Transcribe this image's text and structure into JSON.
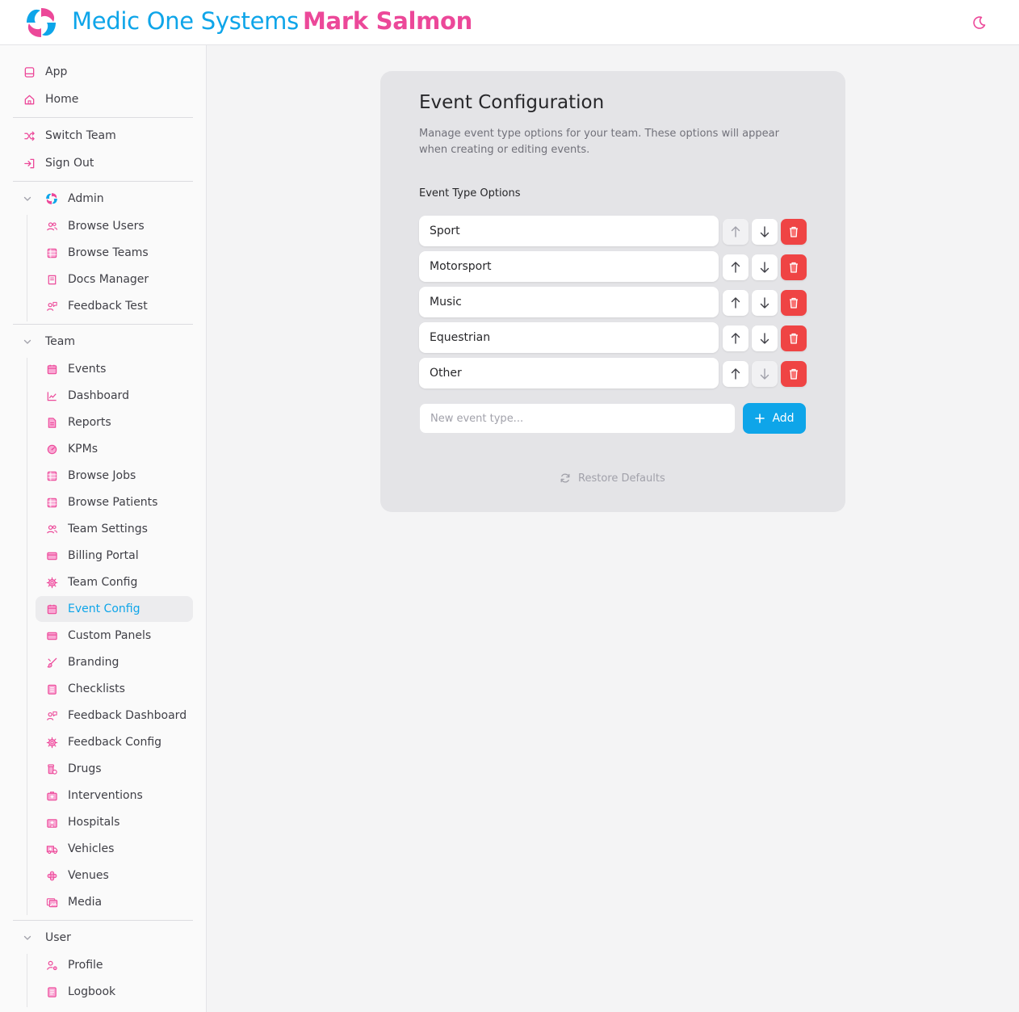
{
  "header": {
    "brand": "Medic One Systems",
    "user_name": "Mark Salmon",
    "logo_icon": "swirl-logo-icon",
    "theme_icon": "moon-icon"
  },
  "colors": {
    "accent_blue": "#0ea5e9",
    "accent_pink": "#ec4899",
    "danger": "#ef4444"
  },
  "sidebar": {
    "top_items": [
      {
        "label": "App",
        "icon": "app-icon"
      },
      {
        "label": "Home",
        "icon": "home-icon"
      }
    ],
    "account_items": [
      {
        "label": "Switch Team",
        "icon": "shuffle-icon"
      },
      {
        "label": "Sign Out",
        "icon": "sign-out-icon"
      }
    ],
    "admin": {
      "label": "Admin",
      "items": [
        {
          "label": "Browse Users",
          "icon": "users-icon"
        },
        {
          "label": "Browse Teams",
          "icon": "table-icon"
        },
        {
          "label": "Docs Manager",
          "icon": "book-icon"
        },
        {
          "label": "Feedback Test",
          "icon": "user-feedback-icon"
        }
      ]
    },
    "team": {
      "label": "Team",
      "items": [
        {
          "label": "Events",
          "icon": "calendar-icon"
        },
        {
          "label": "Dashboard",
          "icon": "chart-icon"
        },
        {
          "label": "Reports",
          "icon": "document-icon"
        },
        {
          "label": "KPMs",
          "icon": "gauge-icon"
        },
        {
          "label": "Browse Jobs",
          "icon": "table-icon"
        },
        {
          "label": "Browse Patients",
          "icon": "table-icon"
        },
        {
          "label": "Team Settings",
          "icon": "users-icon"
        },
        {
          "label": "Billing Portal",
          "icon": "credit-card-icon"
        },
        {
          "label": "Team Config",
          "icon": "cog-icon"
        },
        {
          "label": "Event Config",
          "icon": "calendar-icon",
          "active": true
        },
        {
          "label": "Custom Panels",
          "icon": "credit-card-icon"
        },
        {
          "label": "Branding",
          "icon": "brush-icon"
        },
        {
          "label": "Checklists",
          "icon": "clipboard-icon"
        },
        {
          "label": "Feedback Dashboard",
          "icon": "user-feedback-icon"
        },
        {
          "label": "Feedback Config",
          "icon": "cog-icon"
        },
        {
          "label": "Drugs",
          "icon": "pill-bottle-icon"
        },
        {
          "label": "Interventions",
          "icon": "medical-bag-icon"
        },
        {
          "label": "Hospitals",
          "icon": "hospital-icon"
        },
        {
          "label": "Vehicles",
          "icon": "ambulance-icon"
        },
        {
          "label": "Venues",
          "icon": "flower-icon"
        },
        {
          "label": "Media",
          "icon": "images-icon"
        }
      ]
    },
    "user": {
      "label": "User",
      "items": [
        {
          "label": "Profile",
          "icon": "user-cog-icon"
        },
        {
          "label": "Logbook",
          "icon": "notebook-icon"
        }
      ]
    }
  },
  "main": {
    "title": "Event Configuration",
    "description": "Manage event type options for your team. These options will appear when creating or editing events.",
    "section_label": "Event Type Options",
    "options": [
      {
        "label": "Sport",
        "up_disabled": true,
        "down_disabled": false
      },
      {
        "label": "Motorsport",
        "up_disabled": false,
        "down_disabled": false
      },
      {
        "label": "Music",
        "up_disabled": false,
        "down_disabled": false
      },
      {
        "label": "Equestrian",
        "up_disabled": false,
        "down_disabled": false
      },
      {
        "label": "Other",
        "up_disabled": false,
        "down_disabled": true
      }
    ],
    "new_placeholder": "New event type...",
    "add_label": "Add",
    "restore_label": "Restore Defaults"
  }
}
